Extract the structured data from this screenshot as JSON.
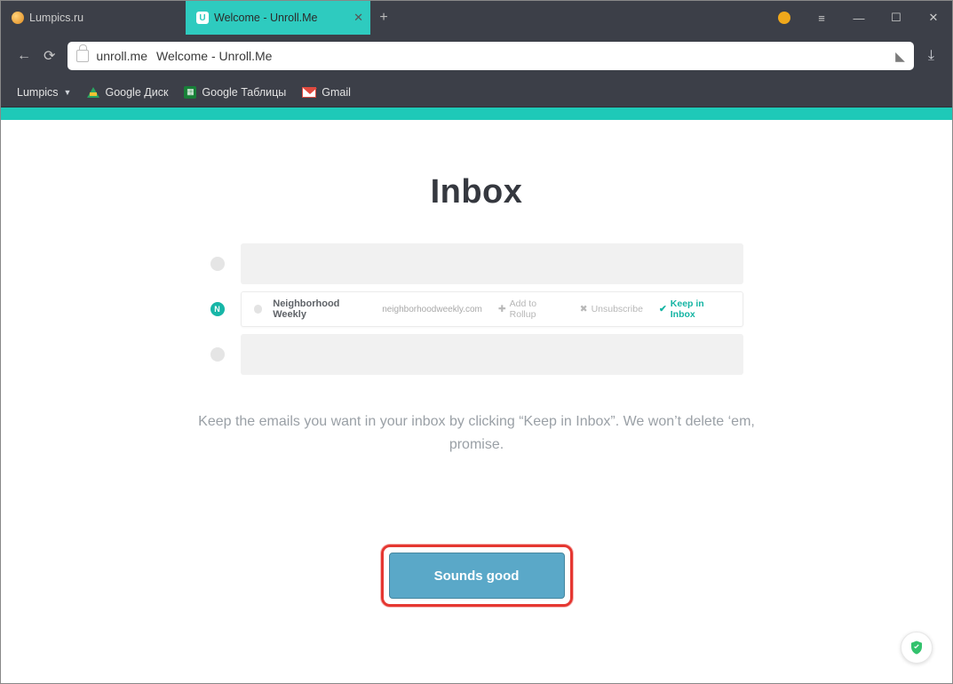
{
  "browser": {
    "tabs": [
      {
        "label": "Lumpics.ru"
      },
      {
        "label": "Welcome - Unroll.Me"
      }
    ],
    "url_domain": "unroll.me",
    "url_title": "Welcome - Unroll.Me"
  },
  "bookmarks": {
    "menu": "Lumpics",
    "items": [
      {
        "label": "Google Диск"
      },
      {
        "label": "Google Таблицы"
      },
      {
        "label": "Gmail"
      }
    ]
  },
  "page": {
    "title": "Inbox",
    "sample_row": {
      "sender": "Neighborhood Weekly",
      "domain": "neighborhoodweekly.com",
      "add_label": "Add to Rollup",
      "unsub_label": "Unsubscribe",
      "keep_label": "Keep in Inbox",
      "badge": "N"
    },
    "explain": "Keep the emails you want in your inbox by clicking “Keep in Inbox”. We won’t delete ‘em, promise.",
    "cta": "Sounds good"
  }
}
